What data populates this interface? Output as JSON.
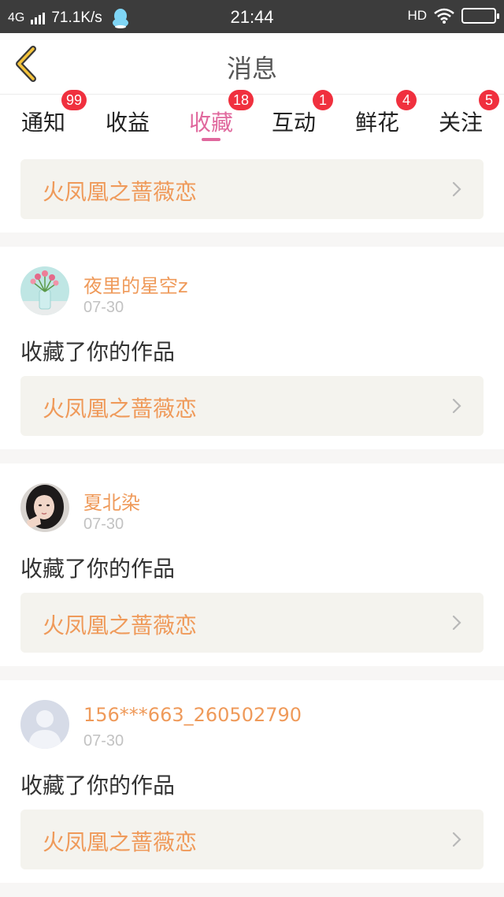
{
  "status_bar": {
    "network": "4G",
    "speed": "71.1K/s",
    "time": "21:44",
    "hd": "HD"
  },
  "header": {
    "title": "消息"
  },
  "tabs": [
    {
      "label": "通知",
      "badge": "99",
      "active": false
    },
    {
      "label": "收益",
      "badge": "",
      "active": false
    },
    {
      "label": "收藏",
      "badge": "18",
      "active": true
    },
    {
      "label": "互动",
      "badge": "1",
      "active": false
    },
    {
      "label": "鲜花",
      "badge": "4",
      "active": false
    },
    {
      "label": "关注",
      "badge": "5",
      "active": false
    }
  ],
  "feed": {
    "first_work": "火凤凰之蔷薇恋",
    "items": [
      {
        "username": "夜里的星空z",
        "date": "07-30",
        "action": "收藏了你的作品",
        "work": "火凤凰之蔷薇恋",
        "avatar": "tulip-avatar"
      },
      {
        "username": "夏北染",
        "date": "07-30",
        "action": "收藏了你的作品",
        "work": "火凤凰之蔷薇恋",
        "avatar": "girl-avatar"
      },
      {
        "username": "156***663_260502790",
        "date": "07-30",
        "action": "收藏了你的作品",
        "work": "火凤凰之蔷薇恋",
        "avatar": "default-avatar"
      }
    ]
  },
  "colors": {
    "accent": "#e0689d",
    "badge": "#f0303e",
    "work_text": "#ef9a5a",
    "status_bar": "#3c3c3c"
  }
}
